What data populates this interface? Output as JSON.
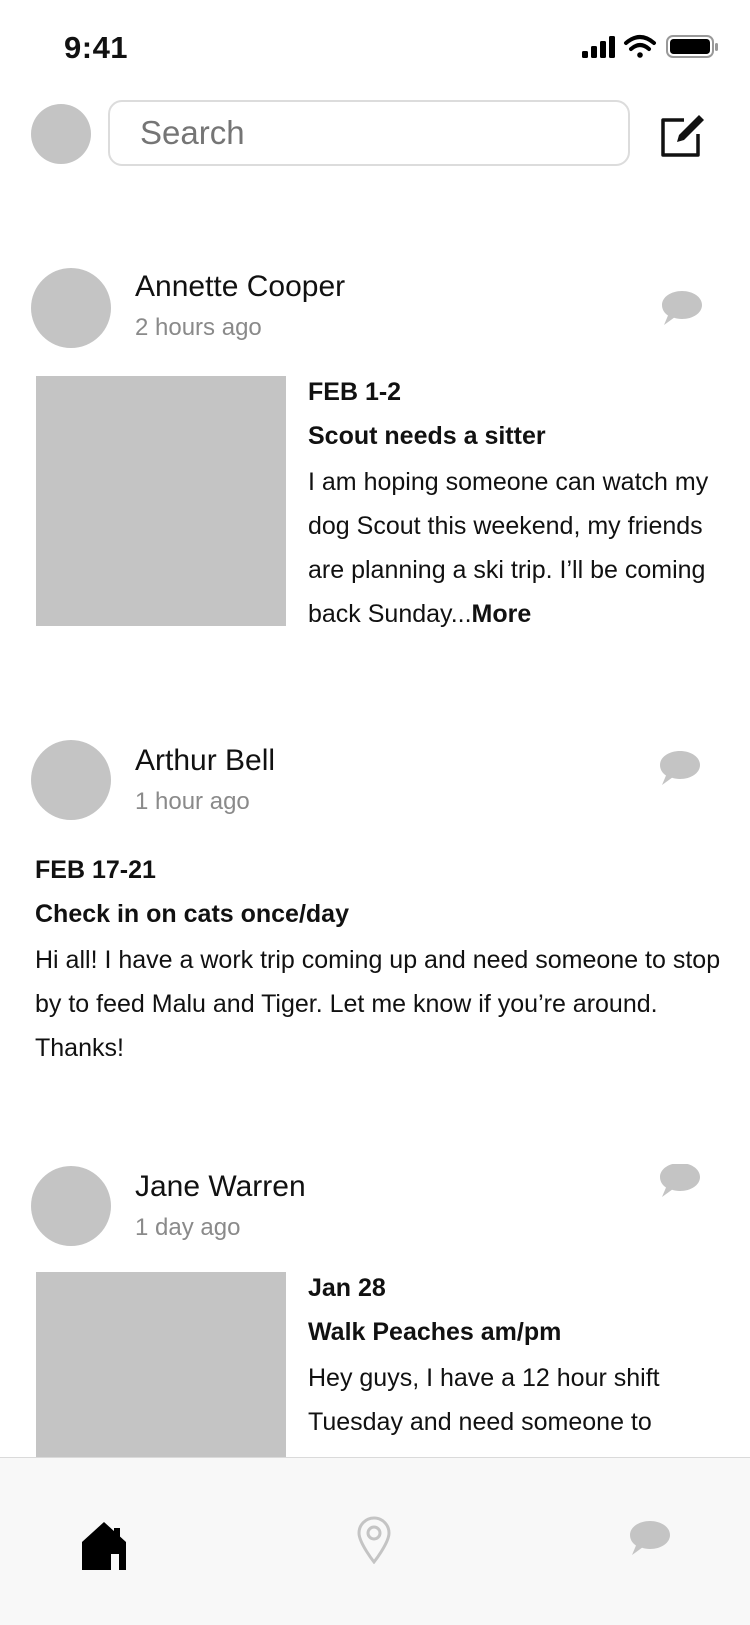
{
  "status": {
    "time": "9:41"
  },
  "search": {
    "placeholder": "Search"
  },
  "posts": [
    {
      "author": "Annette Cooper",
      "time": "2 hours ago",
      "date": "FEB 1-2",
      "title": "Scout needs a sitter",
      "body": "I am hoping someone can watch my dog Scout this weekend, my friends are planning a ski trip. I’ll be coming back Sunday...",
      "more": "More"
    },
    {
      "author": "Arthur Bell",
      "time": "1 hour ago",
      "date": "FEB 17-21",
      "title": "Check in on cats once/day",
      "body": "Hi all! I have a work trip coming up and need someone to stop by to feed Malu and Tiger. Let me know if you’re around. Thanks!"
    },
    {
      "author": "Jane Warren",
      "time": "1 day ago",
      "date": "Jan 28",
      "title": "Walk Peaches am/pm",
      "body": "Hey guys, I have a 12 hour shift Tuesday and need someone to"
    }
  ],
  "tabbar": {
    "items": [
      {
        "icon": "home-icon",
        "active": true
      },
      {
        "icon": "map-pin-icon",
        "active": false
      },
      {
        "icon": "chat-bubble-icon",
        "active": false
      }
    ]
  },
  "colors": {
    "placeholder_gray": "#c4c4c4",
    "secondary_text": "#8a8a8a",
    "active_tab": "#000000",
    "inactive_tab": "#c4c4c4"
  }
}
